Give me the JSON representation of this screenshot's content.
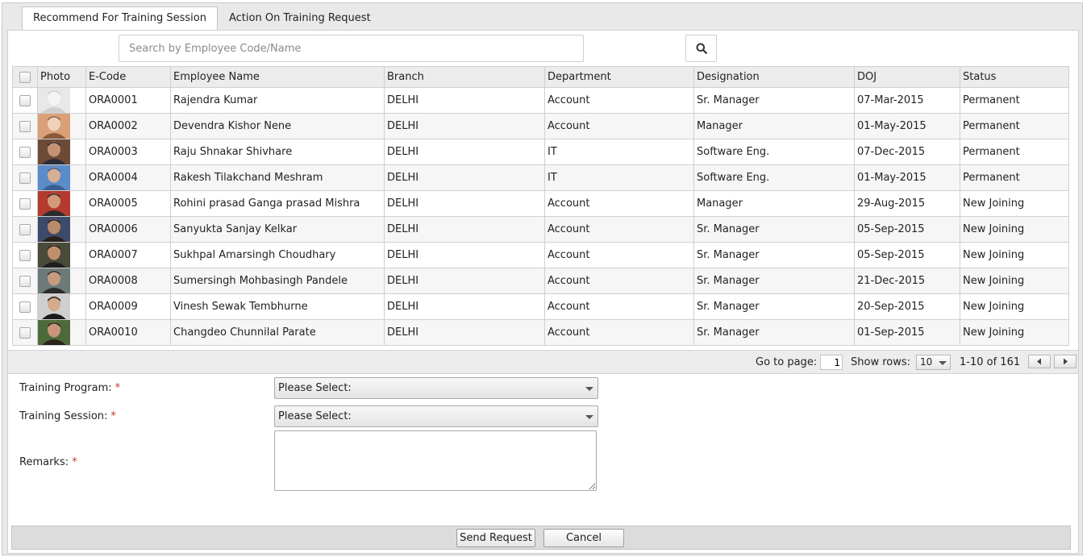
{
  "tabs": [
    {
      "label": "Recommend For Training Session",
      "active": true
    },
    {
      "label": "Action On Training Request",
      "active": false
    }
  ],
  "search": {
    "placeholder": "Search by Employee Code/Name",
    "value": ""
  },
  "table": {
    "headers": [
      "Photo",
      "E-Code",
      "Employee Name",
      "Branch",
      "Department",
      "Designation",
      "DOJ",
      "Status"
    ],
    "rows": [
      {
        "ecode": "ORA0001",
        "name": "Rajendra Kumar",
        "branch": "DELHI",
        "department": "Account",
        "designation": "Sr. Manager",
        "doj": "07-Mar-2015",
        "status": "Permanent"
      },
      {
        "ecode": "ORA0002",
        "name": "Devendra Kishor Nene",
        "branch": "DELHI",
        "department": "Account",
        "designation": "Manager",
        "doj": "01-May-2015",
        "status": "Permanent"
      },
      {
        "ecode": "ORA0003",
        "name": "Raju Shnakar Shivhare",
        "branch": "DELHI",
        "department": "IT",
        "designation": "Software Eng.",
        "doj": "07-Dec-2015",
        "status": "Permanent"
      },
      {
        "ecode": "ORA0004",
        "name": "Rakesh Tilakchand Meshram",
        "branch": "DELHI",
        "department": "IT",
        "designation": "Software Eng.",
        "doj": "01-May-2015",
        "status": "Permanent"
      },
      {
        "ecode": "ORA0005",
        "name": "Rohini prasad Ganga prasad Mishra",
        "branch": "DELHI",
        "department": "Account",
        "designation": "Manager",
        "doj": "29-Aug-2015",
        "status": "New Joining"
      },
      {
        "ecode": "ORA0006",
        "name": "Sanyukta Sanjay Kelkar",
        "branch": "DELHI",
        "department": "Account",
        "designation": "Sr. Manager",
        "doj": "05-Sep-2015",
        "status": "New Joining"
      },
      {
        "ecode": "ORA0007",
        "name": "Sukhpal Amarsingh Choudhary",
        "branch": "DELHI",
        "department": "Account",
        "designation": "Sr. Manager",
        "doj": "05-Sep-2015",
        "status": "New Joining"
      },
      {
        "ecode": "ORA0008",
        "name": "Sumersingh Mohbasingh Pandele",
        "branch": "DELHI",
        "department": "Account",
        "designation": "Sr. Manager",
        "doj": "21-Dec-2015",
        "status": "New Joining"
      },
      {
        "ecode": "ORA0009",
        "name": "Vinesh Sewak Tembhurne",
        "branch": "DELHI",
        "department": "Account",
        "designation": "Sr. Manager",
        "doj": "20-Sep-2015",
        "status": "New Joining"
      },
      {
        "ecode": "ORA0010",
        "name": "Changdeo Chunnilal Parate",
        "branch": "DELHI",
        "department": "Account",
        "designation": "Sr. Manager",
        "doj": "01-Sep-2015",
        "status": "New Joining"
      }
    ]
  },
  "pager": {
    "goto_label": "Go to page:",
    "page_value": "1",
    "rows_label": "Show rows:",
    "rows_value": "10",
    "range": "1-10 of 161"
  },
  "form": {
    "program_label": "Training Program:",
    "program_value": "Please Select:",
    "session_label": "Training Session:",
    "session_value": "Please Select:",
    "remarks_label": "Remarks:",
    "required_mark": "*"
  },
  "buttons": {
    "send": "Send Request",
    "cancel": "Cancel"
  },
  "icons": {
    "search": "search-icon",
    "prev": "triangle-left-icon",
    "next": "triangle-right-icon",
    "dropdown": "chevron-down-icon"
  },
  "colors": {
    "required": "#c0392b",
    "header_bg": "#ececec",
    "border": "#cfcfcf"
  }
}
